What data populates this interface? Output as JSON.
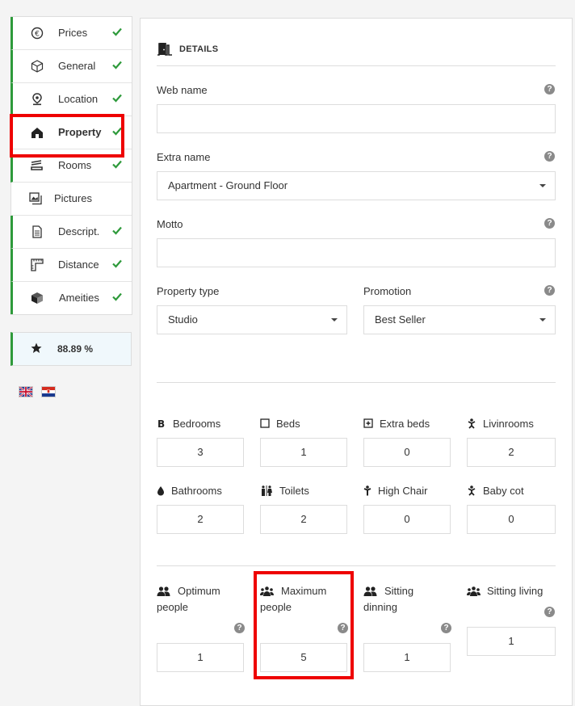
{
  "sidebar": {
    "items": [
      {
        "label": "Prices",
        "icon": "euro-icon",
        "done": true
      },
      {
        "label": "General",
        "icon": "cube-icon",
        "done": true
      },
      {
        "label": "Location",
        "icon": "map-pin-icon",
        "done": true
      },
      {
        "label": "Property",
        "icon": "house-icon",
        "done": true
      },
      {
        "label": "Rooms",
        "icon": "bed-icon",
        "done": true
      },
      {
        "label": "Pictures",
        "icon": "pictures-icon",
        "done": false
      },
      {
        "label": "Descript.",
        "icon": "document-icon",
        "done": true
      },
      {
        "label": "Distance",
        "icon": "ruler-icon",
        "done": true
      },
      {
        "label": "Ameities",
        "icon": "box-icon",
        "done": true
      }
    ],
    "score": "88.89 %"
  },
  "details": {
    "title": "DETAILS",
    "web_name": {
      "label": "Web name",
      "value": ""
    },
    "extra_name": {
      "label": "Extra name",
      "value": "Apartment - Ground Floor"
    },
    "motto": {
      "label": "Motto",
      "value": ""
    },
    "property_type": {
      "label": "Property type",
      "value": "Studio"
    },
    "promotion": {
      "label": "Promotion",
      "value": "Best Seller"
    }
  },
  "counts": [
    {
      "label": "Bedrooms",
      "value": "3",
      "icon": "bed-b-icon"
    },
    {
      "label": "Beds",
      "value": "1",
      "icon": "square-icon"
    },
    {
      "label": "Extra beds",
      "value": "0",
      "icon": "plus-square-icon"
    },
    {
      "label": "Livinrooms",
      "value": "2",
      "icon": "person-icon"
    },
    {
      "label": "Bathrooms",
      "value": "2",
      "icon": "drop-icon"
    },
    {
      "label": "Toilets",
      "value": "2",
      "icon": "toilet-icon"
    },
    {
      "label": "High Chair",
      "value": "0",
      "icon": "child-icon"
    },
    {
      "label": "Baby cot",
      "value": "0",
      "icon": "baby-icon"
    }
  ],
  "people": [
    {
      "label1": "Optimum",
      "label2": "people",
      "value": "1"
    },
    {
      "label1": "Maximum",
      "label2": "people",
      "value": "5"
    },
    {
      "label1": "Sitting",
      "label2": "dinning",
      "value": "1"
    },
    {
      "label1": "Sitting living",
      "label2": "",
      "value": "1"
    }
  ],
  "colors": {
    "done": "#2e9a3b",
    "highlight": "#ee0000"
  }
}
